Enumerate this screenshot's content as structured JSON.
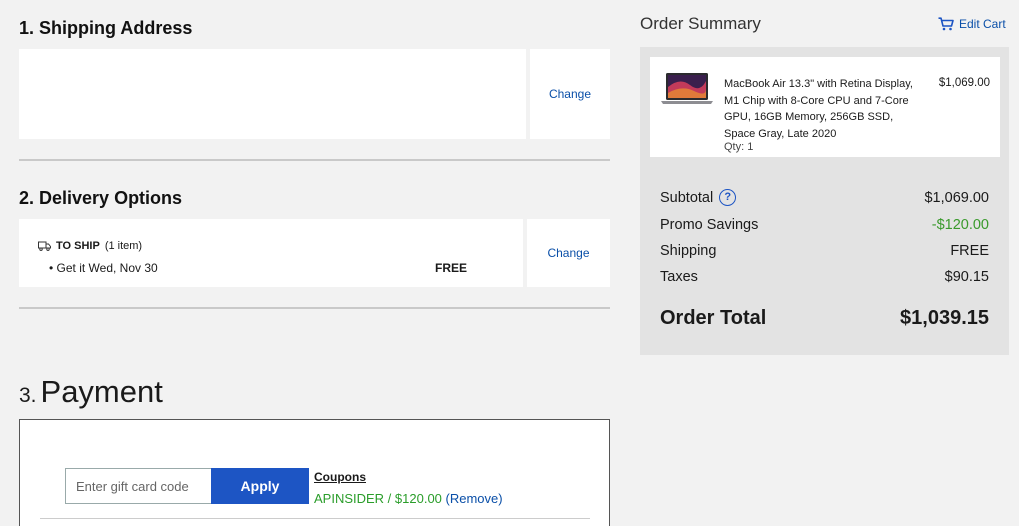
{
  "shipping": {
    "title": "1. Shipping Address",
    "change_label": "Change"
  },
  "delivery": {
    "title": "2. Delivery Options",
    "to_ship_label": "TO SHIP",
    "item_count": "(1 item)",
    "date_text": "Get it Wed, Nov 30",
    "price": "FREE",
    "change_label": "Change"
  },
  "payment": {
    "number": "3.",
    "title": "Payment",
    "gift_placeholder": "Enter gift card code",
    "apply_label": "Apply",
    "coupons_label": "Coupons",
    "coupon_code": "APINSIDER / $120.00",
    "remove_label": "(Remove)"
  },
  "summary": {
    "title": "Order Summary",
    "edit_cart_label": "Edit Cart",
    "item": {
      "name": "MacBook Air 13.3\" with Retina Display, M1 Chip with 8-Core CPU and 7-Core GPU, 16GB Memory, 256GB SSD, Space Gray, Late 2020",
      "qty": "Qty: 1",
      "price": "$1,069.00"
    },
    "subtotal_label": "Subtotal",
    "subtotal_value": "$1,069.00",
    "promo_label": "Promo Savings",
    "promo_value": "-$120.00",
    "shipping_label": "Shipping",
    "shipping_value": "FREE",
    "taxes_label": "Taxes",
    "taxes_value": "$90.15",
    "total_label": "Order Total",
    "total_value": "$1,039.15"
  },
  "colors": {
    "accent": "#1d55c4",
    "link": "#0a4fa8",
    "promo_green": "#3a9a2c"
  },
  "icons": [
    "truck-icon",
    "cart-icon",
    "help-icon",
    "laptop-thumbnail"
  ]
}
